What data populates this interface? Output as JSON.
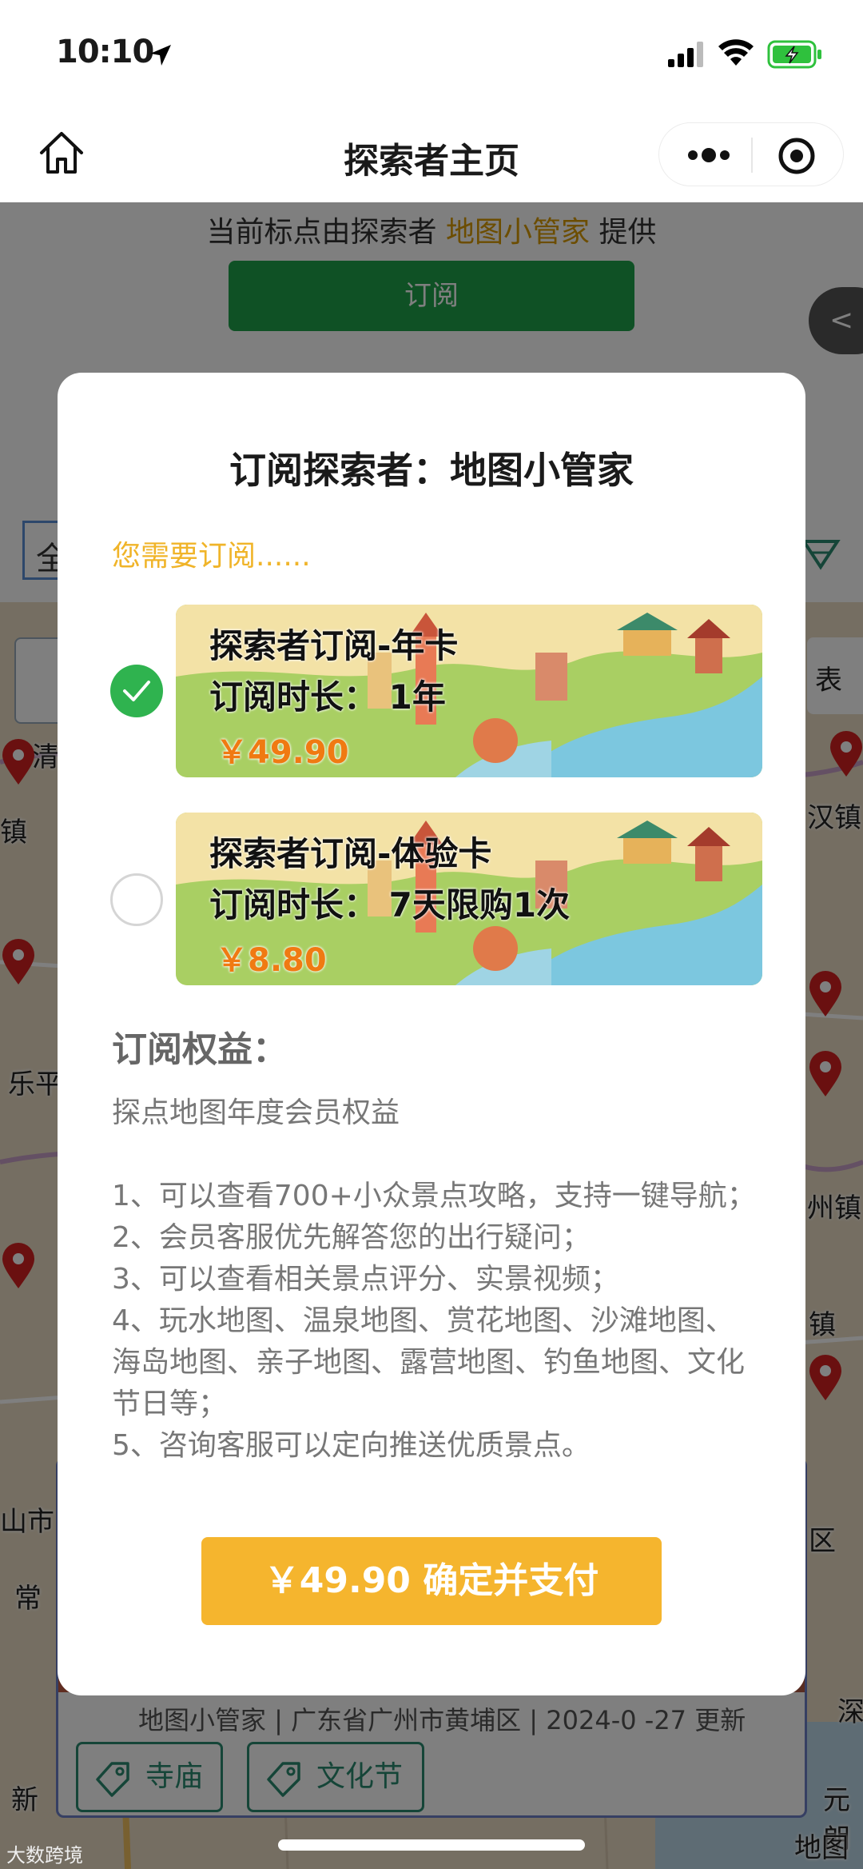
{
  "status_bar": {
    "time": "10:10"
  },
  "nav": {
    "title": "探索者主页"
  },
  "background": {
    "provider_prefix": "当前标点由探索者 ",
    "provider_name": "地图小管家",
    "provider_suffix": " 提供",
    "subscribe_label": "订阅",
    "side_tab": "<",
    "filter_label": "全",
    "map_labels": [
      "清",
      "镇",
      "乐平",
      "山市",
      "常",
      "新",
      "表",
      "汉镇",
      "州镇",
      "镇",
      "区",
      "深",
      "元朗",
      "地图"
    ],
    "card_meta": "地图小管家 | 广东省广州市黄埔区 | 2024-0 -27 更新",
    "tags": [
      "寺庙",
      "文化节"
    ]
  },
  "modal": {
    "title": "订阅探索者：地图小管家",
    "need_subscribe": "您需要订阅......",
    "plans": [
      {
        "name": "探索者订阅-年卡",
        "duration": "订阅时长：  1年",
        "price": "￥49.90",
        "selected": true
      },
      {
        "name": "探索者订阅-体验卡",
        "duration": "订阅时长：  7天限购1次",
        "price": "￥8.80",
        "selected": false
      }
    ],
    "rights_title": "订阅权益：",
    "rights_intro": "探点地图年度会员权益",
    "rights_items": [
      "1、可以查看700+小众景点攻略，支持一键导航；",
      "2、会员客服优先解答您的出行疑问；",
      "3、可以查看相关景点评分、实景视频；",
      "4、玩水地图、温泉地图、赏花地图、沙滩地图、海岛地图、亲子地图、露营地图、钓鱼地图、文化节日等；",
      "5、咨询客服可以定向推送优质景点。"
    ],
    "pay_button": "￥49.90 确定并支付"
  },
  "watermark": "大数跨境",
  "colors": {
    "accent_green": "#1ea24a",
    "check_green": "#2fb34f",
    "pay_yellow": "#f5b52e",
    "provider_gold": "#d99a00",
    "price_orange": "#f07a12"
  }
}
